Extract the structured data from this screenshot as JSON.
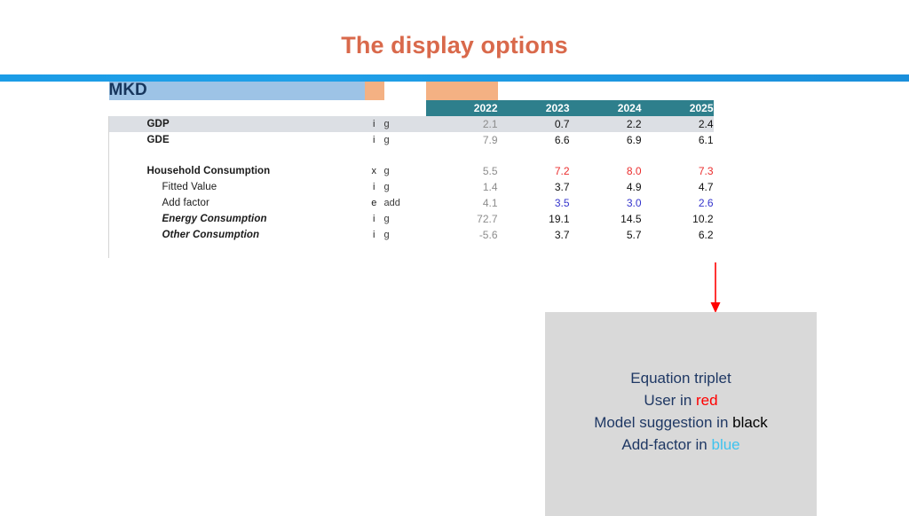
{
  "slide": {
    "title": "The display options",
    "title_color": "#D9694B",
    "accent_bar_color": "#1C9BE5"
  },
  "spreadsheet": {
    "banner_label": "MKD",
    "banner_color": "#9DC3E6",
    "highlight_color": "#F4B183",
    "year_header_color": "#2E7F8C",
    "years": [
      "2022",
      "2023",
      "2024",
      "2025"
    ],
    "rows": [
      {
        "label": "GDP",
        "style": "bold",
        "type": "i",
        "unit": "g",
        "values": [
          "2.1",
          "0.7",
          "2.2",
          "2.4"
        ],
        "value_colors": [
          "hist",
          "black",
          "black",
          "black"
        ],
        "row_shaded": true
      },
      {
        "label": "GDE",
        "style": "bold",
        "type": "i",
        "unit": "g",
        "values": [
          "7.9",
          "6.6",
          "6.9",
          "6.1"
        ],
        "value_colors": [
          "hist",
          "black",
          "black",
          "black"
        ],
        "row_shaded": false
      },
      {
        "label": "",
        "style": "blank",
        "type": "",
        "unit": "",
        "values": [
          "",
          "",
          "",
          ""
        ],
        "value_colors": [
          "black",
          "black",
          "black",
          "black"
        ],
        "row_shaded": false
      },
      {
        "label": "Household Consumption",
        "style": "bold",
        "type": "x",
        "unit": "g",
        "values": [
          "5.5",
          "7.2",
          "8.0",
          "7.3"
        ],
        "value_colors": [
          "hist",
          "red",
          "red",
          "red"
        ],
        "row_shaded": false
      },
      {
        "label": "Fitted Value",
        "style": "indent",
        "type": "i",
        "unit": "g",
        "values": [
          "1.4",
          "3.7",
          "4.9",
          "4.7"
        ],
        "value_colors": [
          "hist",
          "black",
          "black",
          "black"
        ],
        "row_shaded": false
      },
      {
        "label": "Add factor",
        "style": "indent",
        "type": "e",
        "unit": "add",
        "values": [
          "4.1",
          "3.5",
          "3.0",
          "2.6"
        ],
        "value_colors": [
          "hist",
          "blue",
          "blue",
          "blue"
        ],
        "row_shaded": false
      },
      {
        "label": "Energy Consumption",
        "style": "bolditalic",
        "type": "i",
        "unit": "g",
        "values": [
          "72.7",
          "19.1",
          "14.5",
          "10.2"
        ],
        "value_colors": [
          "hist",
          "black",
          "black",
          "black"
        ],
        "row_shaded": false
      },
      {
        "label": "Other Consumption",
        "style": "bolditalic",
        "type": "i",
        "unit": "g",
        "values": [
          "-5.6",
          "3.7",
          "5.7",
          "6.2"
        ],
        "value_colors": [
          "hist",
          "black",
          "black",
          "black"
        ],
        "row_shaded": false
      },
      {
        "label": "",
        "style": "blank",
        "type": "",
        "unit": "",
        "values": [
          "",
          "",
          "",
          ""
        ],
        "value_colors": [
          "black",
          "black",
          "black",
          "black"
        ],
        "row_shaded": false
      }
    ]
  },
  "callout": {
    "box_color": "#D9D9D9",
    "arrow_color": "#FF0000",
    "line1": "Equation triplet",
    "line2_prefix": "User in ",
    "line2_highlight": "red",
    "line3_prefix": "Model suggestion in ",
    "line3_highlight": "black",
    "line4_prefix": "Add-factor in ",
    "line4_highlight": "blue"
  }
}
